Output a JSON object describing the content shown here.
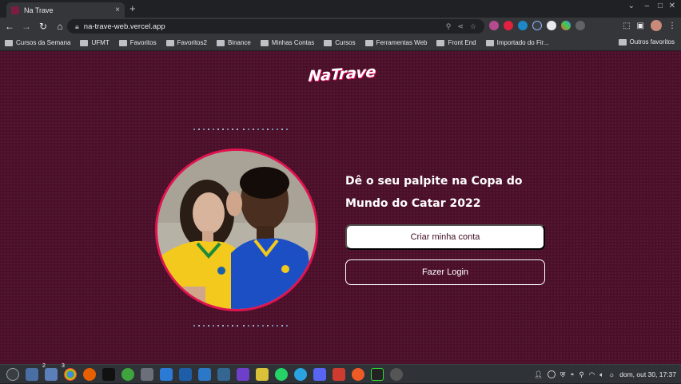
{
  "browser": {
    "tab_title": "Na Trave",
    "tab_close": "×",
    "new_tab": "+",
    "url": "na-trave-web.vercel.app",
    "bookmarks": [
      "Cursos da Semana",
      "UFMT",
      "Favoritos",
      "Favoritos2",
      "Binance",
      "Minhas Contas",
      "Cursos",
      "Ferramentas Web",
      "Front End",
      "Importado do Fir..."
    ],
    "other_bookmarks": "Outros favoritos"
  },
  "page": {
    "logo": "NaTrave",
    "headline": "Dê o seu palpite na Copa do Mundo do Catar 2022",
    "create_account": "Criar minha conta",
    "login": "Fazer Login",
    "photo_alt": "Casal com camisas da seleção brasileira"
  },
  "taskbar": {
    "badges": [
      "2",
      "3"
    ],
    "clock": "dom, out 30, 17:37"
  },
  "colors": {
    "page_bg": "#4b0f29",
    "accent": "#e0134f",
    "text": "#ffffff"
  }
}
